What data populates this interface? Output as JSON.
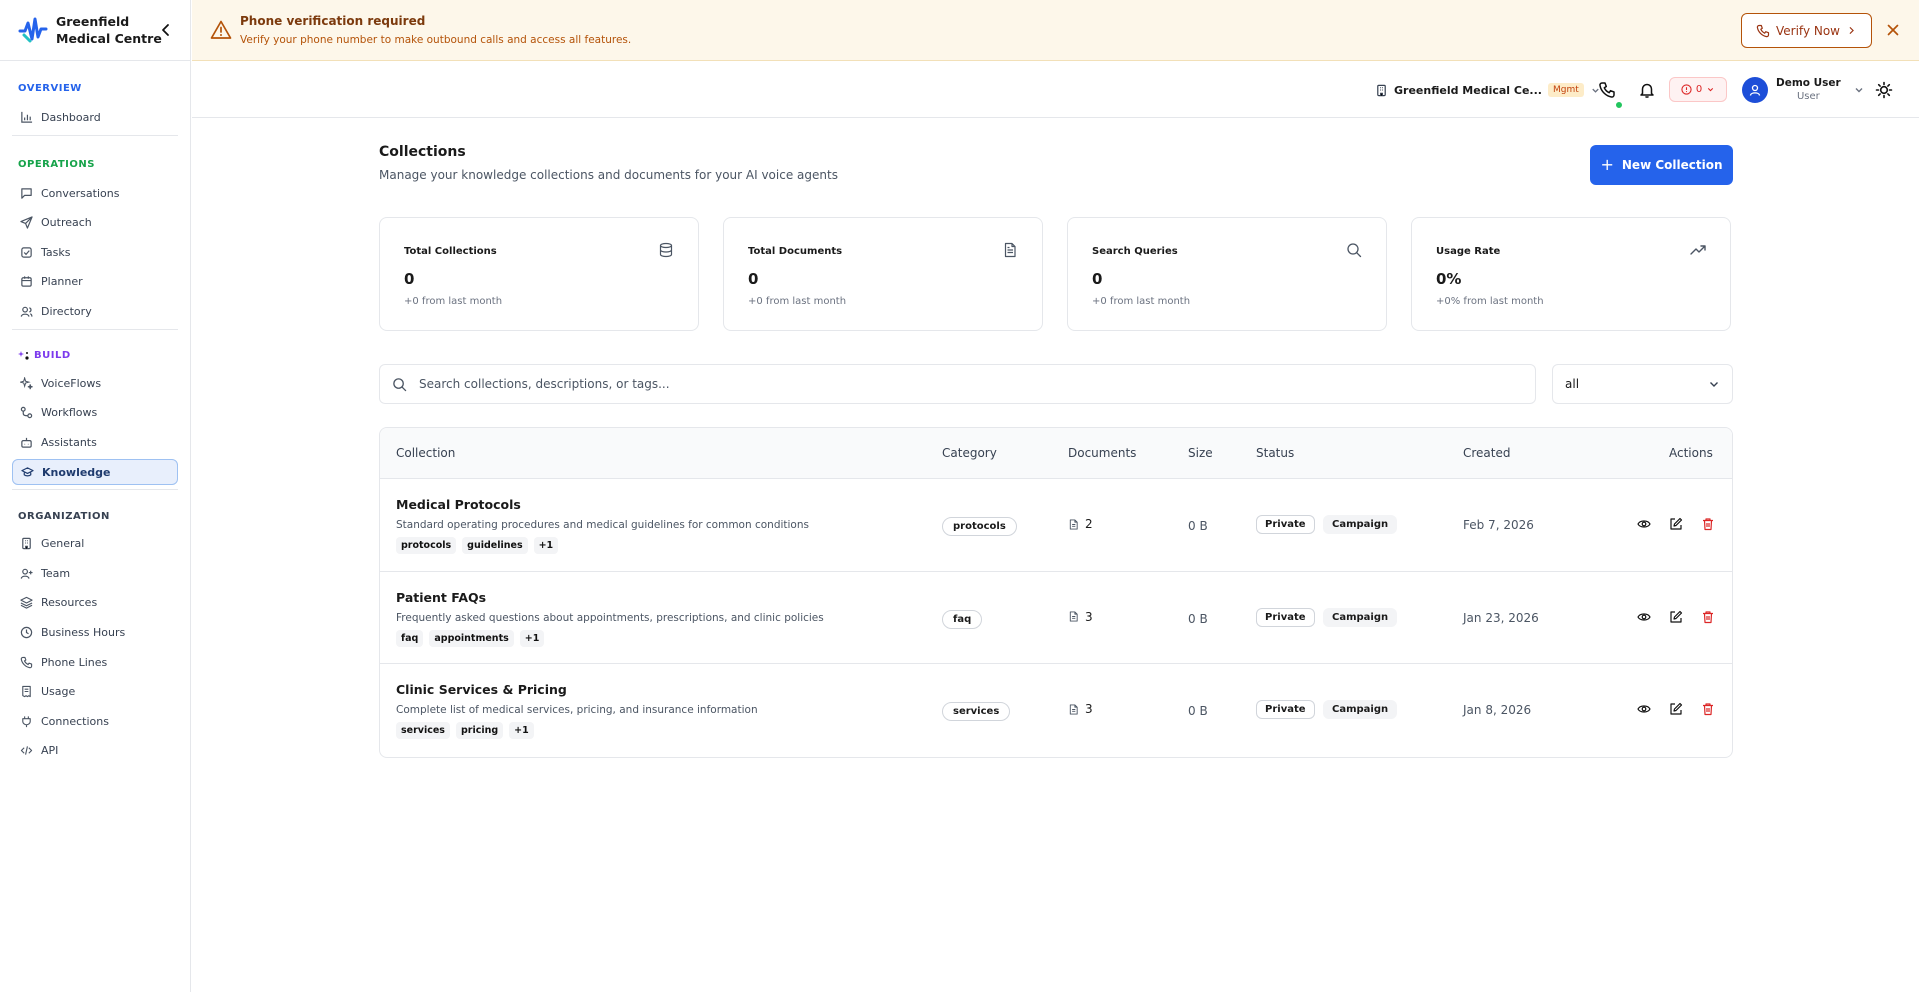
{
  "brand": {
    "name_line1": "Greenfield",
    "name_line2": "Medical Centre"
  },
  "sidebar": {
    "sections": [
      {
        "title": "OVERVIEW",
        "color": "#2563eb"
      },
      {
        "title": "OPERATIONS",
        "color": "#16a34a"
      },
      {
        "title": "BUILD",
        "color": "#7c3aed"
      },
      {
        "title": "ORGANIZATION",
        "color": "#374151"
      }
    ],
    "items": {
      "dashboard": "Dashboard",
      "conversations": "Conversations",
      "outreach": "Outreach",
      "tasks": "Tasks",
      "planner": "Planner",
      "directory": "Directory",
      "voiceflows": "VoiceFlows",
      "workflows": "Workflows",
      "assistants": "Assistants",
      "knowledge": "Knowledge",
      "general": "General",
      "team": "Team",
      "resources": "Resources",
      "business_hours": "Business Hours",
      "phone_lines": "Phone Lines",
      "usage": "Usage",
      "connections": "Connections",
      "api": "API"
    }
  },
  "banner": {
    "title": "Phone verification required",
    "subtitle": "Verify your phone number to make outbound calls and access all features.",
    "button": "Verify Now"
  },
  "header": {
    "org_name": "Greenfield Medical Ce...",
    "org_badge": "Mgmt",
    "alert_count": "0",
    "user_name": "Demo User",
    "user_role": "User"
  },
  "page": {
    "title": "Collections",
    "subtitle": "Manage your knowledge collections and documents for your AI voice agents",
    "new_button": "New Collection"
  },
  "stats": [
    {
      "label": "Total Collections",
      "value": "0",
      "delta": "+0 from last month",
      "icon": "database-icon"
    },
    {
      "label": "Total Documents",
      "value": "0",
      "delta": "+0 from last month",
      "icon": "file-text-icon"
    },
    {
      "label": "Search Queries",
      "value": "0",
      "delta": "+0 from last month",
      "icon": "search-icon"
    },
    {
      "label": "Usage Rate",
      "value": "0%",
      "delta": "+0% from last month",
      "icon": "trending-up-icon"
    }
  ],
  "search": {
    "placeholder": "Search collections, descriptions, or tags..."
  },
  "filter": {
    "value": "all"
  },
  "table": {
    "columns": {
      "collection": "Collection",
      "category": "Category",
      "documents": "Documents",
      "size": "Size",
      "status": "Status",
      "created": "Created",
      "actions": "Actions"
    },
    "rows": [
      {
        "name": "Medical Protocols",
        "description": "Standard operating procedures and medical guidelines for common conditions",
        "tags": [
          "protocols",
          "guidelines",
          "+1"
        ],
        "category": "protocols",
        "documents": "2",
        "size": "0 B",
        "visibility": "Private",
        "type": "Campaign",
        "created": "Feb 7, 2026"
      },
      {
        "name": "Patient FAQs",
        "description": "Frequently asked questions about appointments, prescriptions, and clinic policies",
        "tags": [
          "faq",
          "appointments",
          "+1"
        ],
        "category": "faq",
        "documents": "3",
        "size": "0 B",
        "visibility": "Private",
        "type": "Campaign",
        "created": "Jan 23, 2026"
      },
      {
        "name": "Clinic Services & Pricing",
        "description": "Complete list of medical services, pricing, and insurance information",
        "tags": [
          "services",
          "pricing",
          "+1"
        ],
        "category": "services",
        "documents": "3",
        "size": "0 B",
        "visibility": "Private",
        "type": "Campaign",
        "created": "Jan 8, 2026"
      }
    ]
  },
  "colors": {
    "primary": "#2563eb",
    "warning_bg": "#fdf7ea",
    "danger": "#dc2626",
    "online": "#22c55e"
  }
}
